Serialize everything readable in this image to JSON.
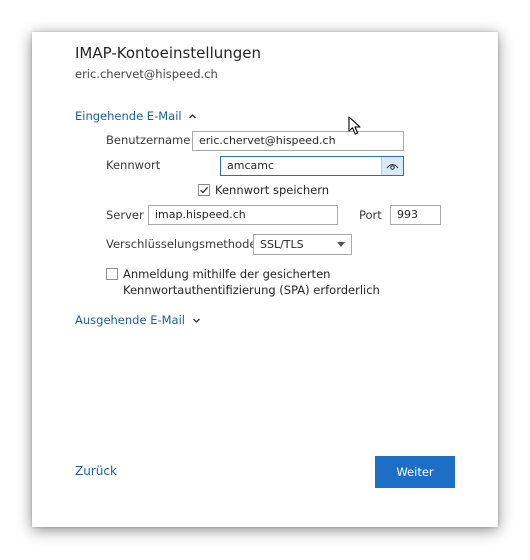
{
  "dialog": {
    "title": "IMAP-Kontoeinstellungen",
    "account_email": "eric.chervet@hispeed.ch"
  },
  "incoming": {
    "section_label": "Eingehende E-Mail",
    "section_icon": "chevron-up-icon",
    "username_label": "Benutzername",
    "username_value": "eric.chervet@hispeed.ch",
    "password_label": "Kennwort",
    "password_value": "amcamc",
    "reveal_icon": "eye-icon",
    "remember_password_label": "Kennwort speichern",
    "remember_password_checked": true,
    "server_label": "Server",
    "server_value": "imap.hispeed.ch",
    "port_label": "Port",
    "port_value": "993",
    "encryption_label": "Verschlüsselungsmethode",
    "encryption_value": "SSL/TLS",
    "spa_label_line1": "Anmeldung mithilfe der gesicherten",
    "spa_label_line2": "Kennwortauthentifizierung (SPA) erforderlich",
    "spa_checked": false
  },
  "outgoing": {
    "section_label": "Ausgehende E-Mail",
    "section_icon": "chevron-down-icon"
  },
  "footer": {
    "back_label": "Zurück",
    "next_label": "Weiter"
  },
  "colors": {
    "link": "#1f5e9c",
    "primary_button": "#1d6ec5",
    "focus_border": "#2f6db3"
  }
}
